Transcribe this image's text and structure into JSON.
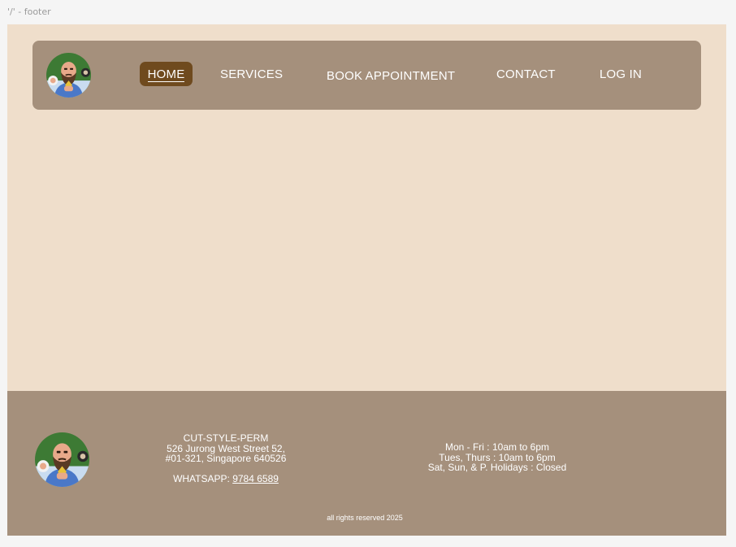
{
  "frame_label": "'/' - footer",
  "nav": {
    "logo_icon": "barber-avatar-icon",
    "items": [
      {
        "label": "HOME",
        "active": true
      },
      {
        "label": "SERVICES"
      },
      {
        "label": "BOOK APPOINTMENT"
      },
      {
        "label": "CONTACT"
      },
      {
        "label": "LOG IN"
      }
    ]
  },
  "footer": {
    "logo_icon": "barber-avatar-icon",
    "address": {
      "name": "CUT-STYLE-PERM",
      "line1": "526 Jurong West Street 52,",
      "line2": "#01-321, Singapore 640526"
    },
    "whatsapp_label": "WHATSAPP: ",
    "whatsapp_number": "9784 6589",
    "hours": [
      "Mon - Fri : 10am to 6pm",
      "Tues, Thurs : 10am to 6pm",
      "Sat, Sun, & P. Holidays : Closed"
    ],
    "copyright": "all rights reserved 2025"
  },
  "colors": {
    "page_background": "#efdecb",
    "bar_background": "#a5907c",
    "active_nav": "#6f4a1e",
    "text": "#ffffff"
  }
}
